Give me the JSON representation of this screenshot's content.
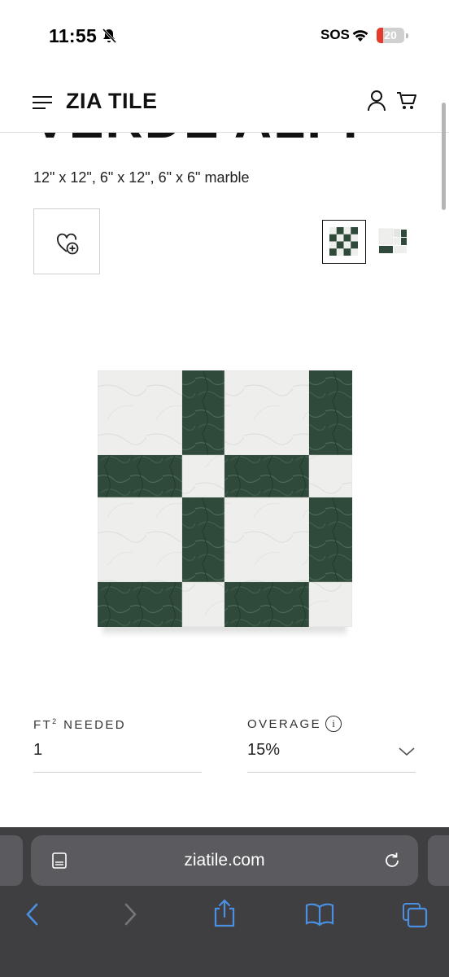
{
  "status_bar": {
    "time": "11:55",
    "sos": "SOS",
    "battery": "20"
  },
  "header": {
    "logo": "ZIA TILE",
    "icons": [
      "menu-icon",
      "account-icon",
      "cart-icon"
    ]
  },
  "product": {
    "title": "VERDE ALPI",
    "subtitle": "12\" x 12\", 6\" x 12\", 6\" x 6\" marble",
    "wishlist_icon": "heart-plus-icon",
    "thumbnails": [
      "checker-pattern",
      "tile-samples"
    ]
  },
  "calculator": {
    "sqft_label": "FT",
    "sqft_sup": "2",
    "sqft_label_rest": " NEEDED",
    "sqft_value": "1",
    "overage_label": "OVERAGE",
    "overage_value": "15%"
  },
  "browser": {
    "url": "ziatile.com"
  },
  "colors": {
    "marble_green": "#2f4a3a",
    "marble_white": "#eeeeec",
    "browser_bg": "#3f3f42",
    "link_blue": "#4a90e2"
  }
}
